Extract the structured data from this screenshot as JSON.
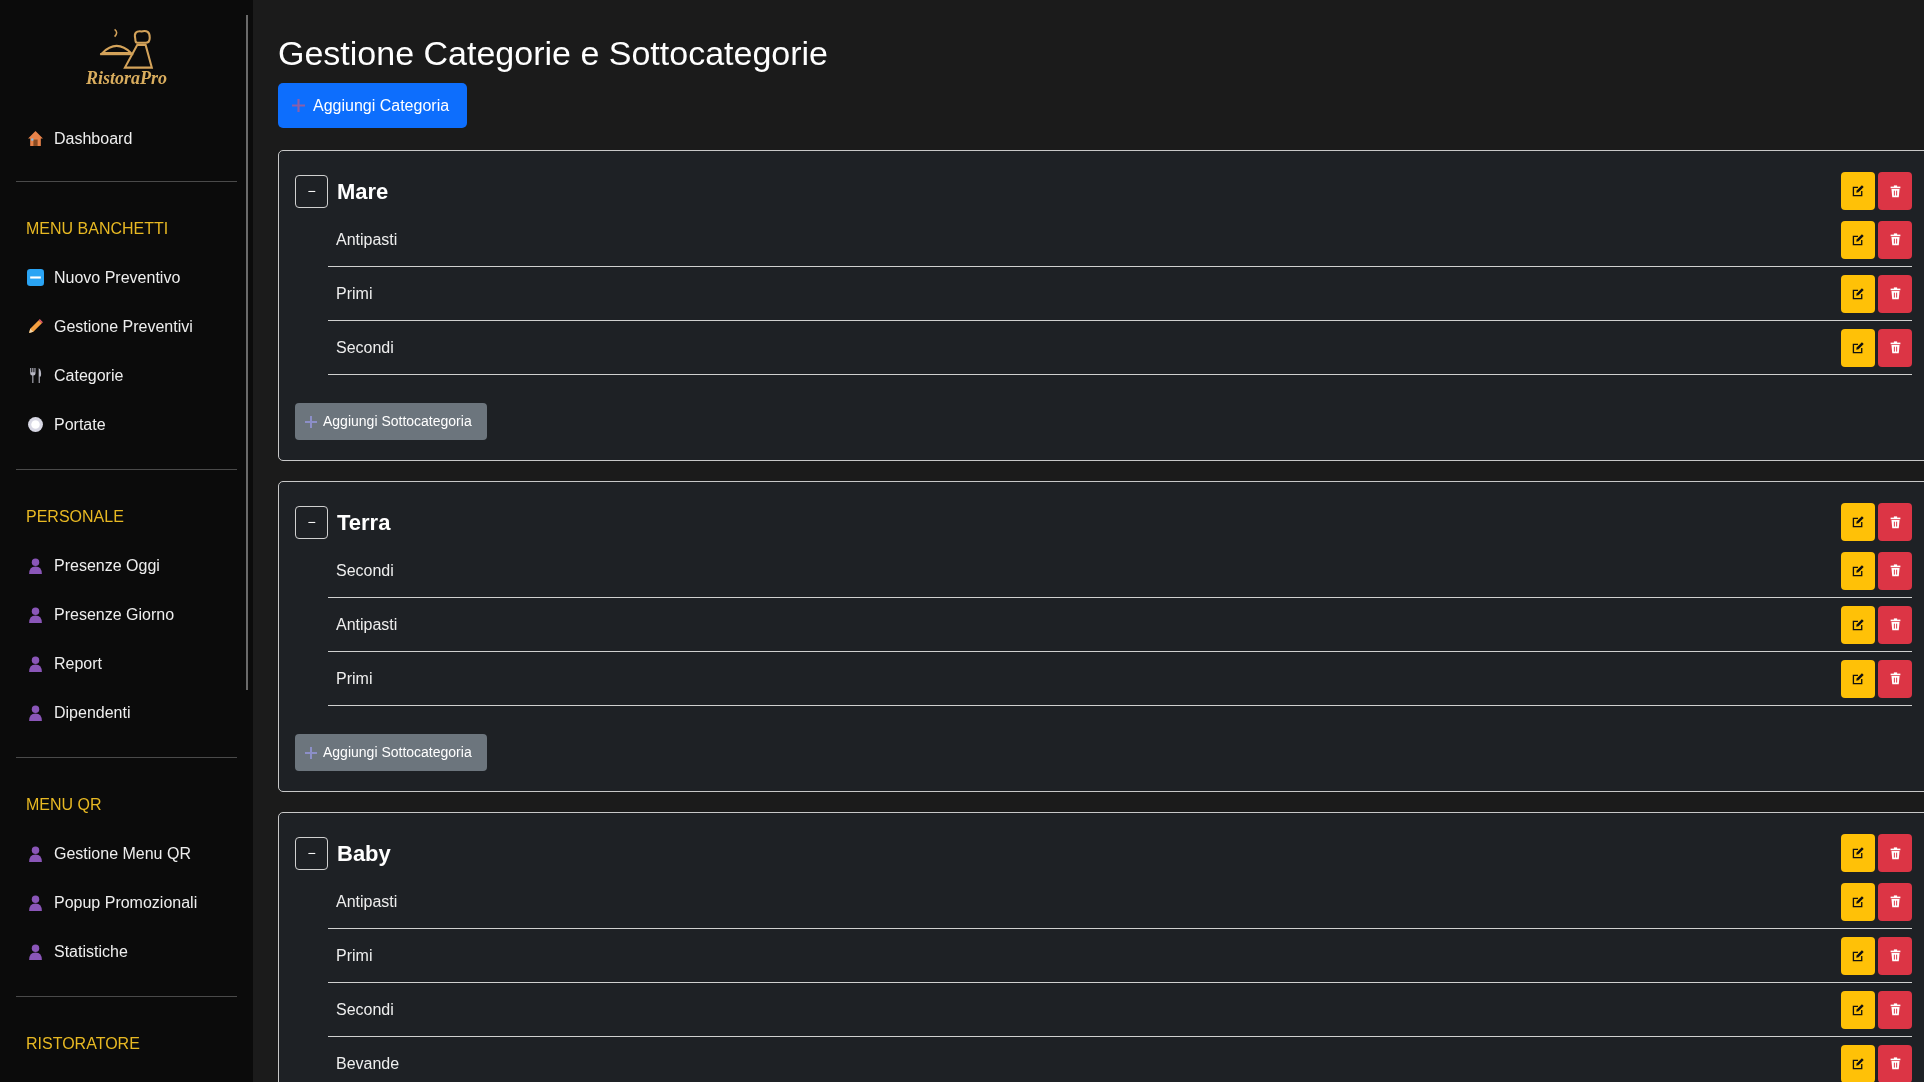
{
  "sidebar": {
    "logo_text": "RistoraPro",
    "sections": [
      {
        "items": [
          {
            "label": "Dashboard",
            "kind": "house"
          }
        ]
      },
      {
        "heading": "MENU BANCHETTI",
        "items": [
          {
            "label": "Nuovo Preventivo",
            "kind": "new"
          },
          {
            "label": "Gestione Preventivi",
            "kind": "pencil"
          },
          {
            "label": "Categorie",
            "kind": "cutlery"
          },
          {
            "label": "Portate",
            "kind": "plate"
          }
        ]
      },
      {
        "heading": "PERSONALE",
        "items": [
          {
            "label": "Presenze Oggi",
            "kind": "person"
          },
          {
            "label": "Presenze Giorno",
            "kind": "person"
          },
          {
            "label": "Report",
            "kind": "person"
          },
          {
            "label": "Dipendenti",
            "kind": "person"
          }
        ]
      },
      {
        "heading": "MENU QR",
        "items": [
          {
            "label": "Gestione Menu QR",
            "kind": "person"
          },
          {
            "label": "Popup Promozionali",
            "kind": "person"
          },
          {
            "label": "Statistiche",
            "kind": "person"
          }
        ]
      },
      {
        "heading": "RISTORATORE"
      }
    ]
  },
  "page": {
    "title": "Gestione Categorie e Sottocategorie",
    "add_category_button": "Aggiungi Categoria"
  },
  "categories": [
    {
      "name": "Mare",
      "toggle": "−",
      "subcategories": [
        "Antipasti",
        "Primi",
        "Secondi"
      ],
      "add_subcategory_button": "Aggiungi Sottocategoria"
    },
    {
      "name": "Terra",
      "toggle": "−",
      "subcategories": [
        "Secondi",
        "Antipasti",
        "Primi"
      ],
      "add_subcategory_button": "Aggiungi Sottocategoria"
    },
    {
      "name": "Baby",
      "toggle": "−",
      "subcategories": [
        "Antipasti",
        "Primi",
        "Secondi",
        "Bevande"
      ]
    }
  ]
}
